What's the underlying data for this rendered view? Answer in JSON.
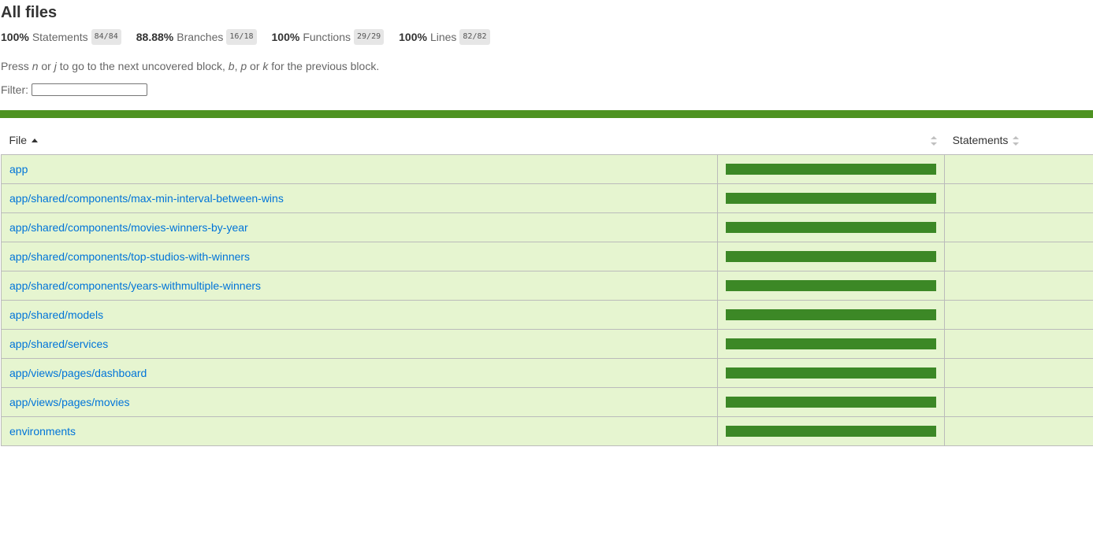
{
  "title": "All files",
  "summary": [
    {
      "name": "statements",
      "pct": "100%",
      "label": "Statements",
      "fraction": "84/84"
    },
    {
      "name": "branches",
      "pct": "88.88%",
      "label": "Branches",
      "fraction": "16/18"
    },
    {
      "name": "functions",
      "pct": "100%",
      "label": "Functions",
      "fraction": "29/29"
    },
    {
      "name": "lines",
      "pct": "100%",
      "label": "Lines",
      "fraction": "82/82"
    }
  ],
  "hint": {
    "p1": "Press ",
    "k1": "n",
    "p2": " or ",
    "k2": "j",
    "p3": " to go to the next uncovered block, ",
    "k3": "b",
    "p4": ", ",
    "k4": "p",
    "p5": " or ",
    "k5": "k",
    "p6": " for the previous block."
  },
  "filter": {
    "label": "Filter:",
    "value": ""
  },
  "colors": {
    "status_high": "#4d9221",
    "row_high": "#e6f5d0",
    "bar_fill": "#3c8826",
    "link": "#0074d9"
  },
  "table": {
    "headers": {
      "file": "File",
      "pic": "",
      "statements": "Statements"
    },
    "rows": [
      {
        "file": "app",
        "coverage": 1.0
      },
      {
        "file": "app/shared/components/max-min-interval-between-wins",
        "coverage": 1.0
      },
      {
        "file": "app/shared/components/movies-winners-by-year",
        "coverage": 1.0
      },
      {
        "file": "app/shared/components/top-studios-with-winners",
        "coverage": 1.0
      },
      {
        "file": "app/shared/components/years-withmultiple-winners",
        "coverage": 1.0
      },
      {
        "file": "app/shared/models",
        "coverage": 1.0
      },
      {
        "file": "app/shared/services",
        "coverage": 1.0
      },
      {
        "file": "app/views/pages/dashboard",
        "coverage": 1.0
      },
      {
        "file": "app/views/pages/movies",
        "coverage": 1.0
      },
      {
        "file": "environments",
        "coverage": 1.0
      }
    ]
  }
}
